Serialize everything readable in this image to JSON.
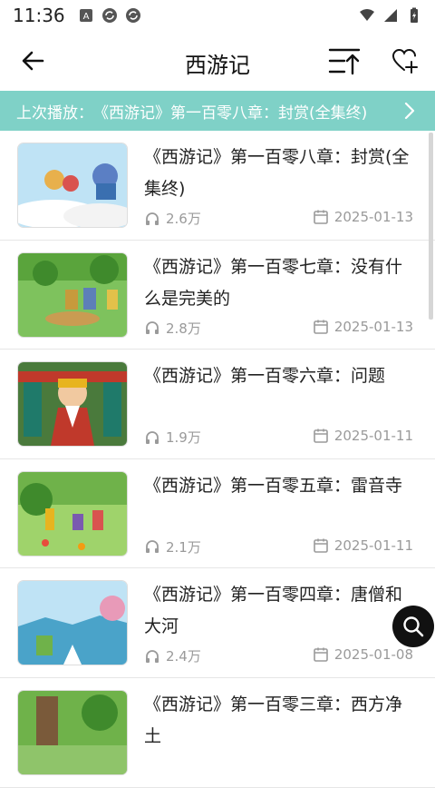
{
  "status": {
    "time": "11:36"
  },
  "header": {
    "title": "西游记"
  },
  "last_play": {
    "label": "上次播放：",
    "episode": "《西游记》第一百零八章：封赏(全集终)"
  },
  "episodes": [
    {
      "title": "《西游记》第一百零八章：封赏(全集终)",
      "plays": "2.6万",
      "date": "2025-01-13"
    },
    {
      "title": "《西游记》第一百零七章：没有什么是完美的",
      "plays": "2.8万",
      "date": "2025-01-13"
    },
    {
      "title": "《西游记》第一百零六章：问题",
      "plays": "1.9万",
      "date": "2025-01-11"
    },
    {
      "title": "《西游记》第一百零五章：雷音寺",
      "plays": "2.1万",
      "date": "2025-01-11"
    },
    {
      "title": "《西游记》第一百零四章：唐僧和大河",
      "plays": "2.4万",
      "date": "2025-01-08"
    },
    {
      "title": "《西游记》第一百零三章：西方净土",
      "plays": "",
      "date": ""
    }
  ],
  "colors": {
    "accent": "#7fd1c7",
    "fab": "#111111"
  },
  "icons": {
    "back": "arrow-left-icon",
    "sort": "sort-icon",
    "favorite": "heart-plus-icon",
    "search": "search-icon"
  }
}
